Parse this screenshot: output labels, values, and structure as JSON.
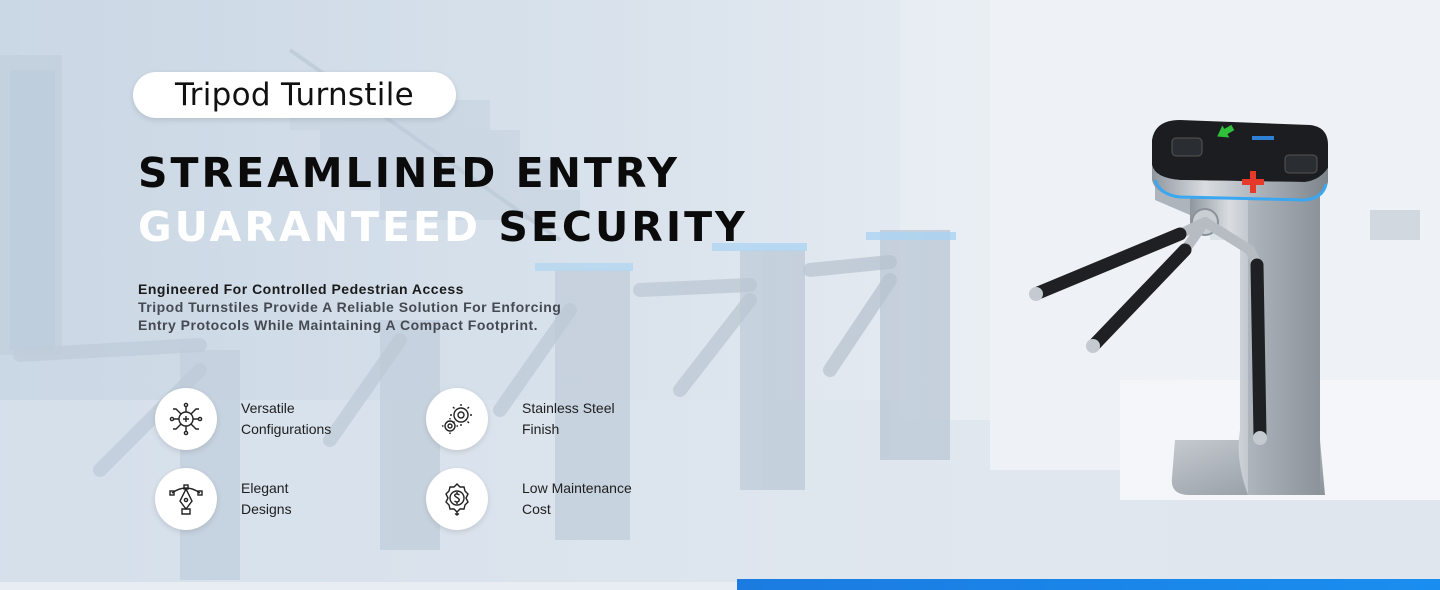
{
  "pill_title": "Tripod Turnstile",
  "headline": {
    "line1": "STREAMLINED ENTRY",
    "line2_highlight": "GUARANTEED",
    "line2_rest": "SECURITY"
  },
  "description": {
    "lead": "Engineered For Controlled Pedestrian Access",
    "body": "Tripod Turnstiles Provide A Reliable Solution For Enforcing Entry Protocols While Maintaining A Compact Footprint."
  },
  "features": [
    {
      "line1": "Versatile",
      "line2": "Configurations",
      "icon": "circuit-icon"
    },
    {
      "line1": "Stainless Steel",
      "line2": "Finish",
      "icon": "gears-icon"
    },
    {
      "line1": "Elegant",
      "line2": "Designs",
      "icon": "pen-tool-icon"
    },
    {
      "line1": "Low Maintenance",
      "line2": "Cost",
      "icon": "dollar-gear-icon"
    }
  ],
  "colors": {
    "accent": "#1a8ef0",
    "dark_text": "#0b0b0b",
    "highlight_text": "#ffffff",
    "arrow_green": "#2fbf3a",
    "cross_red": "#e53a2a"
  }
}
